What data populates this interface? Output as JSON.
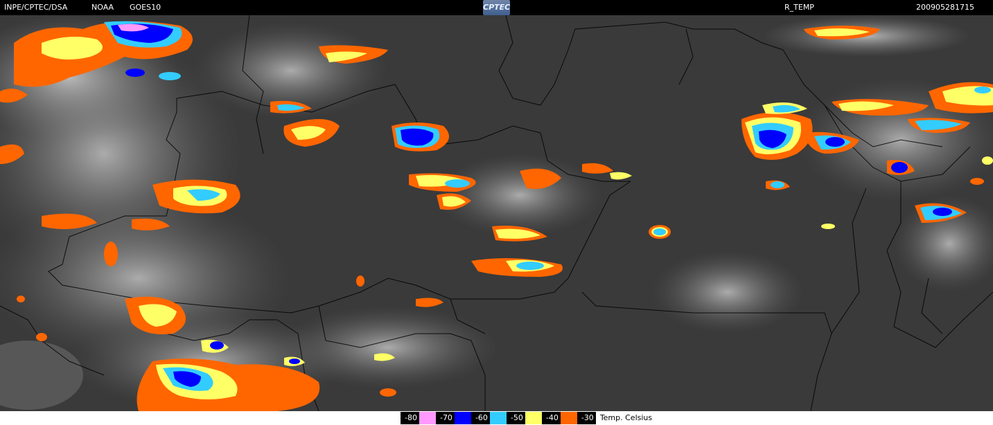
{
  "header": {
    "source": "INPE/CPTEC/DSA",
    "agency": "NOAA",
    "satellite": "GOES10",
    "logo_text": "CPTEC",
    "product": "R_TEMP",
    "timestamp": "200905281715"
  },
  "legend": {
    "title": "Temp. Celsius",
    "items": [
      {
        "label": "-80",
        "color": "#ff99ff"
      },
      {
        "label": "-70",
        "color": "#0000ff"
      },
      {
        "label": "-60",
        "color": "#33ccff"
      },
      {
        "label": "-50",
        "color": "#ffff66"
      },
      {
        "label": "-40",
        "color": "#ff6600"
      },
      {
        "label": "-30",
        "color": "#ffffff"
      }
    ]
  }
}
